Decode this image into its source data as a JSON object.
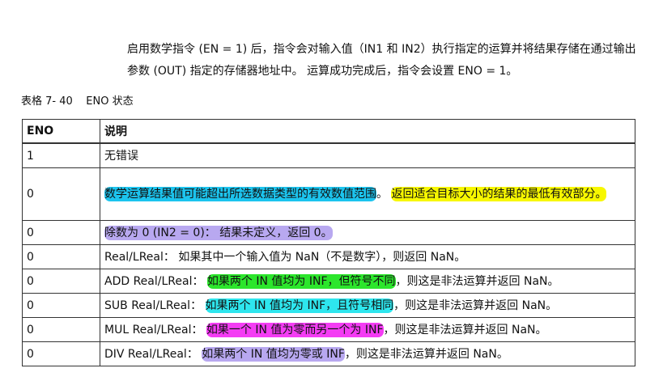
{
  "intro": {
    "text": "启用数学指令 (EN = 1) 后，指令会对输入值（IN1 和 IN2）执行指定的运算并将结果存储在通过输出参数 (OUT) 指定的存储器地址中。 运算成功完成后，指令会设置 ENO = 1。"
  },
  "caption": {
    "text": "表格 7- 40    ENO 状态"
  },
  "colors": {
    "blue": "#1cc4ee",
    "yellow": "#f7f700",
    "lavender": "#b8a8f0",
    "green": "#2ce62c",
    "cyan": "#2ee6ee",
    "magenta": "#f43cf4"
  },
  "table": {
    "headers": {
      "eno": "ENO",
      "desc": "说明"
    },
    "rows": [
      {
        "eno": "1",
        "segments": [
          {
            "text": "无错误",
            "hl": ""
          }
        ]
      },
      {
        "eno": "0",
        "segments": [
          {
            "text": "数学运算结果值可能超出所选数据类型的有效数值范围",
            "hl": "blue"
          },
          {
            "text": "。 ",
            "hl": ""
          },
          {
            "text": "返回适合目标大小的结果的最低有效部分。",
            "hl": "yellow"
          }
        ]
      },
      {
        "eno": "0",
        "segments": [
          {
            "text": "除数为 0 (IN2 = 0)： 结果未定义，返回 0。",
            "hl": "lavender"
          }
        ]
      },
      {
        "eno": "0",
        "segments": [
          {
            "text": "Real/LReal： 如果其中一个输入值为 NaN（不是数字），则返回 NaN。",
            "hl": ""
          }
        ]
      },
      {
        "eno": "0",
        "segments": [
          {
            "text": "ADD Real/LReal： ",
            "hl": ""
          },
          {
            "text": "如果两个 IN 值均为 INF，但符号不同",
            "hl": "green"
          },
          {
            "text": "，则这是非法运算并返回 NaN。",
            "hl": ""
          }
        ]
      },
      {
        "eno": "0",
        "segments": [
          {
            "text": "SUB Real/LReal： ",
            "hl": ""
          },
          {
            "text": "如果两个 IN 值均为 INF，且符号相同",
            "hl": "cyan"
          },
          {
            "text": "，则这是非法运算并返回 NaN。",
            "hl": ""
          }
        ]
      },
      {
        "eno": "0",
        "segments": [
          {
            "text": "MUL Real/LReal： ",
            "hl": ""
          },
          {
            "text": "如果一个 IN 值为零而另一个为 INF",
            "hl": "magenta"
          },
          {
            "text": "，则这是非法运算并返回 NaN。",
            "hl": ""
          }
        ]
      },
      {
        "eno": "0",
        "segments": [
          {
            "text": "DIV Real/LReal： ",
            "hl": ""
          },
          {
            "text": "如果两个 IN 值均为零或 INF",
            "hl": "lavender"
          },
          {
            "text": "，则这是非法运算并返回 NaN。",
            "hl": ""
          }
        ]
      }
    ]
  }
}
